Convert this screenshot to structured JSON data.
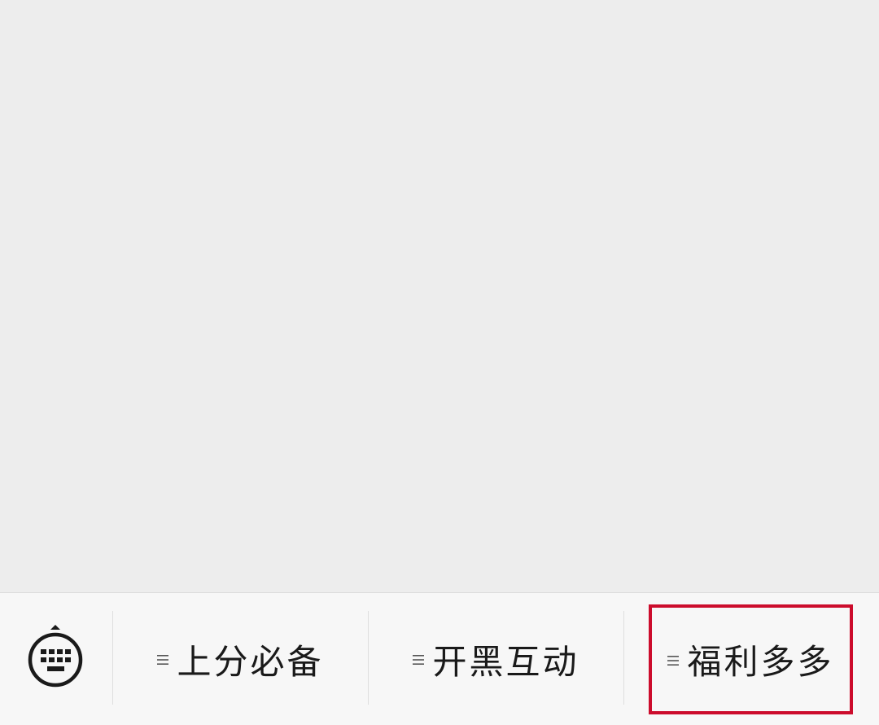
{
  "bottom_menu": {
    "keyboard_toggle_icon": "keyboard-icon",
    "items": [
      {
        "label": "上分必备",
        "icon": "menu-lines-icon"
      },
      {
        "label": "开黑互动",
        "icon": "menu-lines-icon"
      },
      {
        "label": "福利多多",
        "icon": "menu-lines-icon",
        "highlighted": true
      }
    ]
  },
  "colors": {
    "content_background": "#ededed",
    "bar_background": "#f7f7f7",
    "highlight_border": "#cc0c2c",
    "text": "#1a1a1a"
  }
}
